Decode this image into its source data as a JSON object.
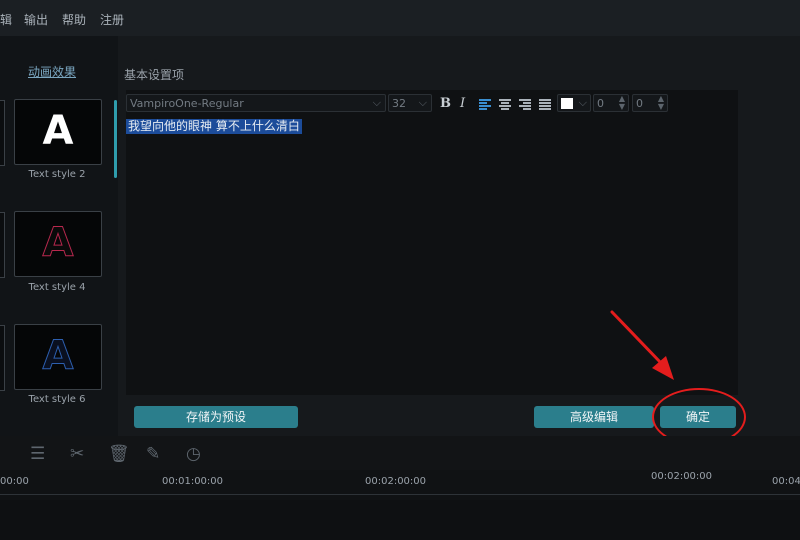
{
  "menu": {
    "items": [
      "辑",
      "输出",
      "帮助",
      "注册"
    ]
  },
  "left_panel": {
    "tab_label": "动画效果",
    "styles": [
      {
        "label": "Text style 2",
        "letter": "A"
      },
      {
        "label": "Text style 4",
        "letter": "A"
      },
      {
        "label": "Text style 6",
        "letter": "A"
      }
    ]
  },
  "dialog": {
    "section_title": "基本设置项",
    "font_family": "VampiroOne-Regular",
    "font_size": "32",
    "bold": "B",
    "italic": "I",
    "spacing_1": "0",
    "spacing_2": "0",
    "text_content": "我望向他的眼神 算不上什么清白",
    "save_preset_label": "存储为预设",
    "advanced_edit_label": "高级编辑",
    "confirm_label": "确定"
  },
  "colors": {
    "accent": "#2b7e8c",
    "selection": "#1c4c9a",
    "annotation": "#e41d1d"
  },
  "timeline": {
    "timecodes": [
      "00:00",
      "00:01:00:00",
      "00:02:00:00",
      "00:02:00:00",
      "00:04"
    ]
  }
}
